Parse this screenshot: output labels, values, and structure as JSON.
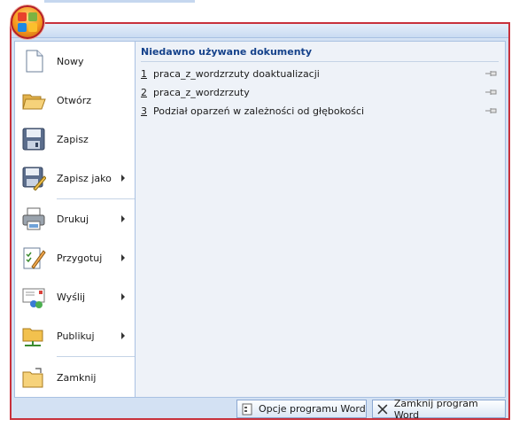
{
  "app": {
    "accent": "#c8313b",
    "pane_bg": "#eef2f8",
    "title_color": "#15428b"
  },
  "office_button": {
    "icon": "office-logo-icon"
  },
  "left_menu": {
    "items": [
      {
        "label": "Nowy",
        "icon": "new-document-icon",
        "has_submenu": false
      },
      {
        "label": "Otwórz",
        "icon": "open-folder-icon",
        "has_submenu": false
      },
      {
        "label": "Zapisz",
        "icon": "save-disk-icon",
        "has_submenu": false
      },
      {
        "label": "Zapisz jako",
        "icon": "save-as-icon",
        "has_submenu": true
      },
      {
        "label": "Drukuj",
        "icon": "printer-icon",
        "has_submenu": true
      },
      {
        "label": "Przygotuj",
        "icon": "prepare-document-icon",
        "has_submenu": true
      },
      {
        "label": "Wyślij",
        "icon": "send-icon",
        "has_submenu": true
      },
      {
        "label": "Publikuj",
        "icon": "publish-icon",
        "has_submenu": true
      },
      {
        "label": "Zamknij",
        "icon": "close-folder-icon",
        "has_submenu": false
      }
    ]
  },
  "recent": {
    "title": "Niedawno używane dokumenty",
    "items": [
      {
        "num": "1",
        "name": "praca_z_wordzrzuty doaktualizacji"
      },
      {
        "num": "2",
        "name": "praca_z_wordzrzuty"
      },
      {
        "num": "3",
        "name": "Podział oparzeń w zależności od głębokości"
      }
    ]
  },
  "bottom": {
    "options_label": "Opcje programu Word",
    "exit_label": "Zamknij program Word"
  }
}
